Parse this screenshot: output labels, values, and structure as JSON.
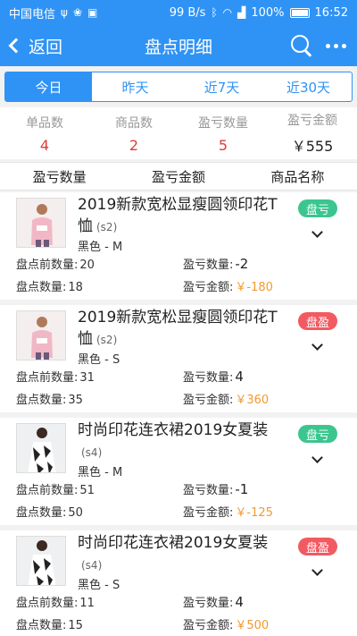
{
  "statusbar": {
    "carrier": "中国电信",
    "speed": "99 B/s",
    "battery": "100%",
    "time": "16:52"
  },
  "navbar": {
    "back_label": "返回",
    "title": "盘点明细"
  },
  "tabs": [
    {
      "label": "今日",
      "active": true
    },
    {
      "label": "昨天",
      "active": false
    },
    {
      "label": "近7天",
      "active": false
    },
    {
      "label": "近30天",
      "active": false
    }
  ],
  "summary": [
    {
      "label": "单品数",
      "value": "4"
    },
    {
      "label": "商品数",
      "value": "2"
    },
    {
      "label": "盈亏数量",
      "value": "5"
    },
    {
      "label": "盈亏金额",
      "value": "￥555"
    }
  ],
  "sortbar": {
    "col1": "盈亏数量",
    "col2": "盈亏金额",
    "col3": "商品名称"
  },
  "labels": {
    "before_qty": "盘点前数量:",
    "after_qty": "盘点数量:",
    "diff_qty": "盈亏数量:",
    "diff_amt": "盈亏金额:"
  },
  "items": [
    {
      "name": "2019新款宽松显瘦圆领印花T恤",
      "code": "(s2)",
      "spec": "黑色 - M",
      "status": "盘亏",
      "status_type": "loss",
      "before_qty": "20",
      "after_qty": "18",
      "diff_qty": "-2",
      "diff_amt": "￥-180",
      "image": "pink-sweater"
    },
    {
      "name": "2019新款宽松显瘦圆领印花T恤",
      "code": "(s2)",
      "spec": "黑色 - S",
      "status": "盘盈",
      "status_type": "gain",
      "before_qty": "31",
      "after_qty": "35",
      "diff_qty": "4",
      "diff_amt": "￥360",
      "image": "pink-sweater"
    },
    {
      "name": "时尚印花连衣裙2019女夏装",
      "code": "(s4)",
      "spec": "黑色 - M",
      "status": "盘亏",
      "status_type": "loss",
      "before_qty": "51",
      "after_qty": "50",
      "diff_qty": "-1",
      "diff_amt": "￥-125",
      "image": "print-dress"
    },
    {
      "name": "时尚印花连衣裙2019女夏装",
      "code": "(s4)",
      "spec": "黑色 - S",
      "status": "盘盈",
      "status_type": "gain",
      "before_qty": "11",
      "after_qty": "15",
      "diff_qty": "4",
      "diff_amt": "￥500",
      "image": "print-dress"
    }
  ],
  "colors": {
    "primary": "#2f93f5",
    "loss_badge": "#3cc58f",
    "gain_badge": "#f25a62",
    "amount": "#f29a2e",
    "summary_red": "#e03a3a"
  }
}
